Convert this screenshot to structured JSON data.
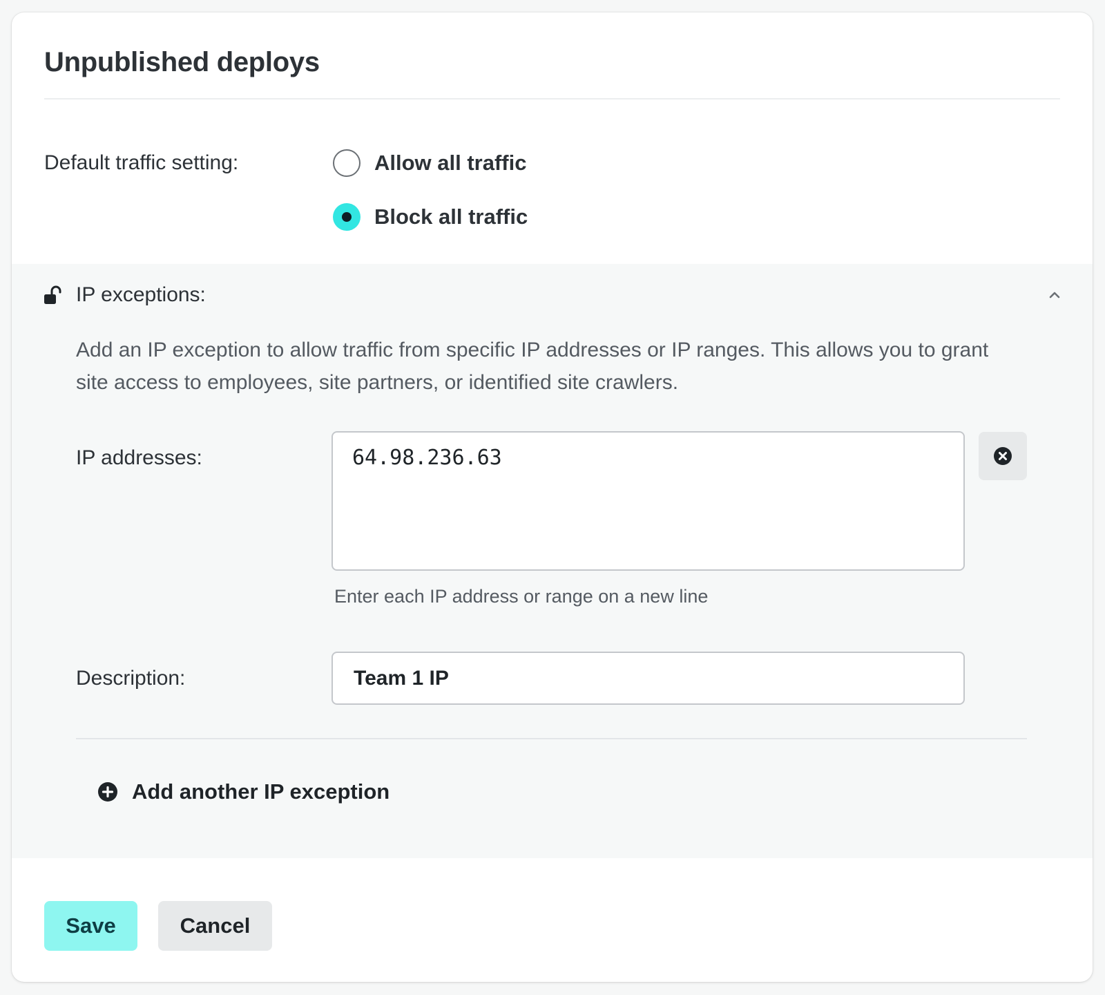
{
  "dialog": {
    "title": "Unpublished deploys"
  },
  "traffic": {
    "label": "Default traffic setting:",
    "options": [
      {
        "label": "Allow all traffic",
        "selected": false
      },
      {
        "label": "Block all traffic",
        "selected": true
      }
    ]
  },
  "ip_exceptions": {
    "title": "IP exceptions:",
    "expanded": true,
    "description": "Add an IP exception to allow traffic from specific IP addresses or IP ranges. This allows you to grant site access to employees, site partners, or identified site crawlers.",
    "ip_addresses_label": "IP addresses:",
    "ip_addresses_value": "64.98.236.63",
    "ip_hint": "Enter each IP address or range on a new line",
    "description_label": "Description:",
    "description_value": "Team 1 IP",
    "add_label": "Add another IP exception"
  },
  "actions": {
    "save_label": "Save",
    "cancel_label": "Cancel"
  },
  "icons": {
    "lock": "unlock-icon",
    "collapse": "chevron-up-icon",
    "remove": "close-circle-icon",
    "add": "plus-circle-icon"
  },
  "colors": {
    "accent": "#32e6e2",
    "save_bg": "#8ef6f0",
    "panel_bg": "#f6f8f8"
  }
}
